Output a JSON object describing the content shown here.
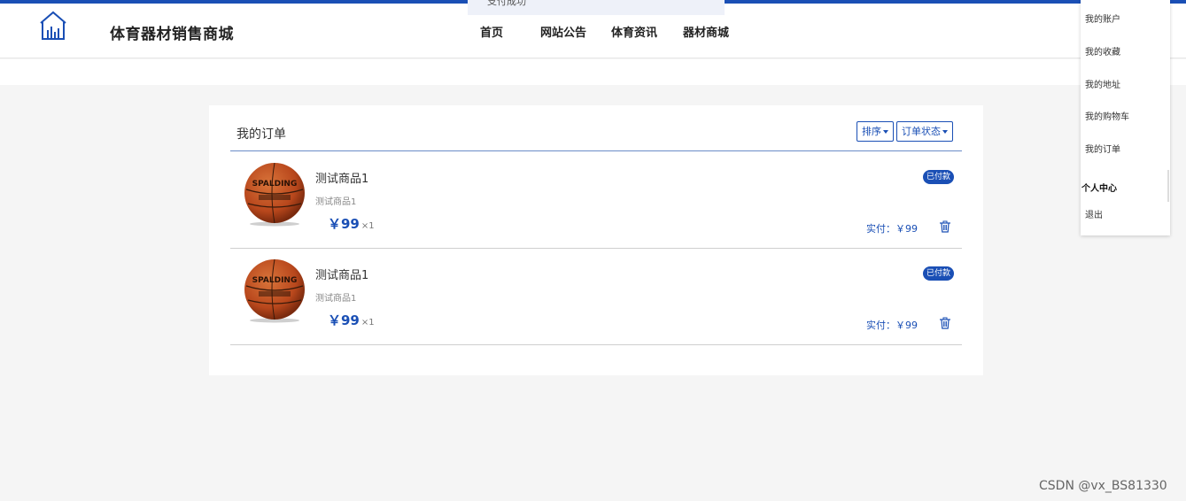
{
  "app": {
    "title": "体育器材销售商城",
    "logo_icon": "building-chart-icon"
  },
  "nav": {
    "items": [
      "首页",
      "网站公告",
      "体育资讯",
      "器材商城"
    ]
  },
  "toast": {
    "text": "支付成功"
  },
  "orders": {
    "title": "我的订单",
    "sort_label": "排序",
    "status_label": "订单状态",
    "items": [
      {
        "name": "测试商品1",
        "desc": "测试商品1",
        "price": "￥99",
        "qty": "×1",
        "status": "已付款",
        "paid": "实付：￥99"
      },
      {
        "name": "测试商品1",
        "desc": "测试商品1",
        "price": "￥99",
        "qty": "×1",
        "status": "已付款",
        "paid": "实付：￥99"
      }
    ]
  },
  "user_menu": {
    "items": [
      "我的账户",
      "我的收藏",
      "我的地址",
      "我的购物车",
      "我的订单"
    ],
    "header": "个人中心",
    "logout": "退出"
  },
  "watermark": "CSDN @vx_BS81330",
  "colors": {
    "accent": "#1a4fb5",
    "background": "#f5f5f5"
  }
}
